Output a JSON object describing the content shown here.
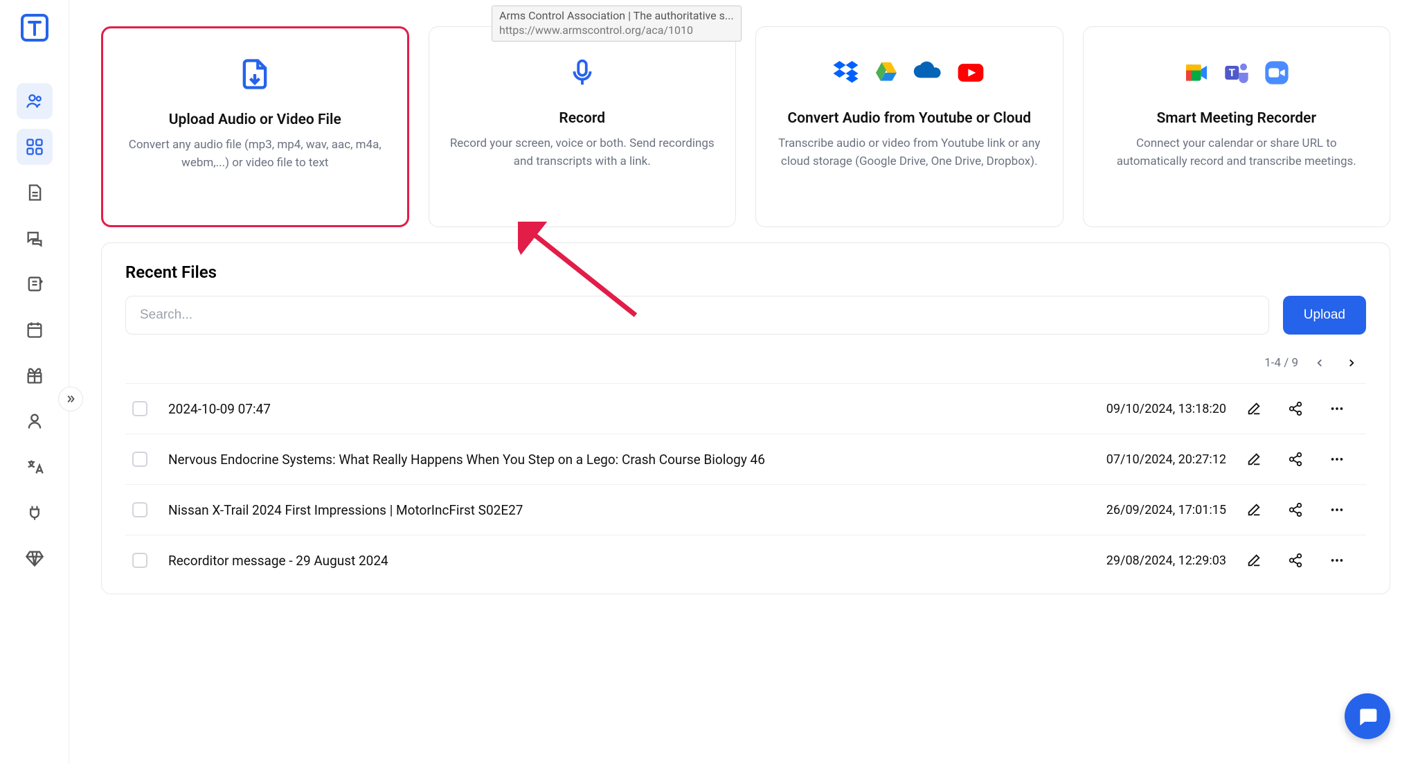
{
  "tooltip": {
    "title": "Arms Control Association | The authoritative s...",
    "url": "https://www.armscontrol.org/aca/1010"
  },
  "cards": {
    "upload": {
      "title": "Upload Audio or Video File",
      "desc": "Convert any audio file (mp3, mp4, wav, aac, m4a, webm,...) or video file to text"
    },
    "record": {
      "title": "Record",
      "desc": "Record your screen, voice or both. Send recordings and transcripts with a link."
    },
    "cloud": {
      "title": "Convert Audio from Youtube or Cloud",
      "desc": "Transcribe audio or video from Youtube link or any cloud storage (Google Drive, One Drive, Dropbox)."
    },
    "meeting": {
      "title": "Smart Meeting Recorder",
      "desc": "Connect your calendar or share URL to automatically record and transcribe meetings."
    }
  },
  "recent": {
    "heading": "Recent Files",
    "search_placeholder": "Search...",
    "upload_label": "Upload",
    "pager_label": "1-4 / 9"
  },
  "files": [
    {
      "title": "2024-10-09 07:47",
      "date": "09/10/2024, 13:18:20"
    },
    {
      "title": "Nervous Endocrine Systems: What Really Happens When You Step on a Lego: Crash Course Biology 46",
      "date": "07/10/2024, 20:27:12"
    },
    {
      "title": "Nissan X-Trail 2024 First Impressions | MotorIncFirst S02E27",
      "date": "26/09/2024, 17:01:15"
    },
    {
      "title": "Recorditor message - 29 August 2024",
      "date": "29/08/2024, 12:29:03"
    }
  ]
}
